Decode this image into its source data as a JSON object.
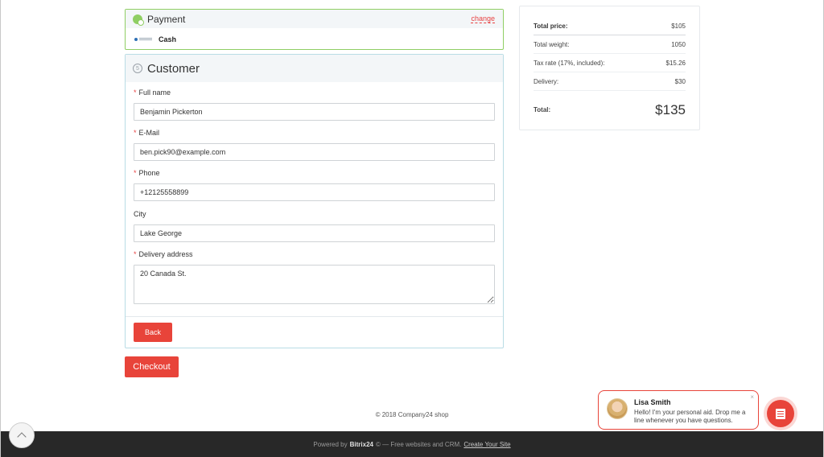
{
  "payment": {
    "title": "Payment",
    "change_label": "change",
    "method_label": "Cash"
  },
  "customer": {
    "step_number": "5",
    "title": "Customer",
    "fields": {
      "full_name": {
        "label": "Full name",
        "value": "Benjamin Pickerton"
      },
      "email": {
        "label": "E-Mail",
        "value": "ben.pick90@example.com"
      },
      "phone": {
        "label": "Phone",
        "value": "+12125558899"
      },
      "city": {
        "label": "City",
        "value": "Lake George"
      },
      "address": {
        "label": "Delivery address",
        "value": "20 Canada St."
      }
    },
    "back_label": "Back",
    "required_mark": "*"
  },
  "checkout_label": "Checkout",
  "totals": {
    "rows": [
      {
        "label": "Total price:",
        "value": "$105"
      },
      {
        "label": "Total weight:",
        "value": "1050"
      },
      {
        "label": "Tax rate (17%, included):",
        "value": "$15.26"
      },
      {
        "label": "Delivery:",
        "value": "$30"
      }
    ],
    "total_label": "Total:",
    "total_value": "$135"
  },
  "footer": {
    "copyright": "© 2018 Company24 shop",
    "powered_by": "Powered by",
    "brand": "Bitrix24",
    "brand_suffix": "© — Free websites and CRM.",
    "create_site": "Create Your Site"
  },
  "chat": {
    "name": "Lisa Smith",
    "message": "Hello! I'm your personal aid. Drop me a line whenever you have questions.",
    "close": "×"
  },
  "colors": {
    "accent": "#e8443a",
    "payment_border": "#8fce63",
    "customer_border": "#b9dce5",
    "footer_bg": "#282828"
  }
}
